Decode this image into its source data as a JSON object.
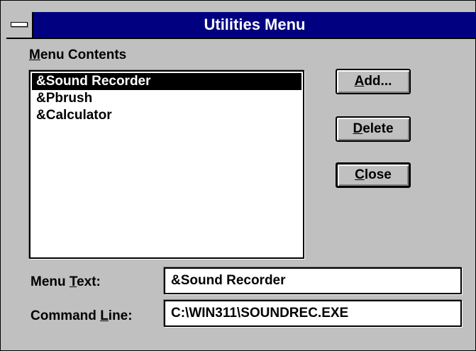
{
  "window": {
    "title": "Utilities Menu"
  },
  "menu_contents": {
    "label_prefix": "",
    "label_accel": "M",
    "label_rest": "enu Contents",
    "items": [
      {
        "label": "&Sound Recorder",
        "selected": true
      },
      {
        "label": "&Pbrush",
        "selected": false
      },
      {
        "label": "&Calculator",
        "selected": false
      }
    ]
  },
  "buttons": {
    "add": {
      "accel": "A",
      "rest": "dd..."
    },
    "delete": {
      "accel": "D",
      "rest": "elete"
    },
    "close": {
      "accel": "C",
      "rest": "lose"
    }
  },
  "menu_text": {
    "label_prefix": "Menu ",
    "label_accel": "T",
    "label_rest": "ext:",
    "value": "&Sound Recorder"
  },
  "command_line": {
    "label_prefix": "Command ",
    "label_accel": "L",
    "label_rest": "ine:",
    "value": "C:\\WIN311\\SOUNDREC.EXE"
  }
}
